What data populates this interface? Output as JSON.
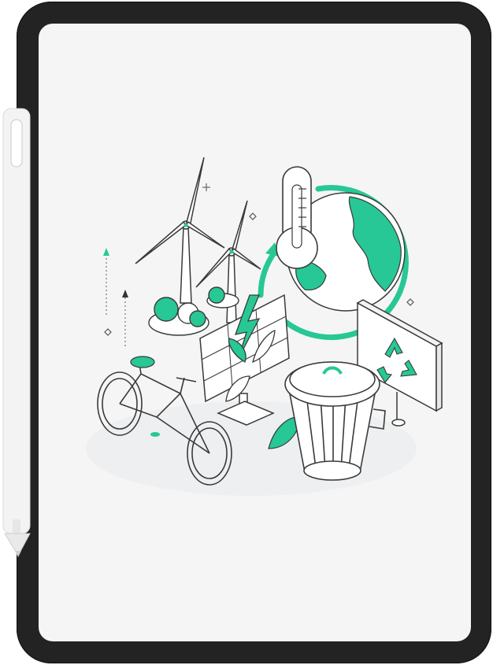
{
  "colors": {
    "bezel": "#232323",
    "screen": "#f5f5f5",
    "accent": "#27c895",
    "line": "#3a3a3a",
    "pencil": "#f3f3f3"
  },
  "icons": [
    "wind-turbine-icon",
    "thermometer-icon",
    "earth-globe-icon",
    "recycling-arrow-icon",
    "recycle-sign-icon",
    "solar-panel-icon",
    "lightning-bolt-icon",
    "plant-sprout-icon",
    "bicycle-icon",
    "trash-bin-icon",
    "leaf-icon",
    "bush-icon",
    "sparkle-icon",
    "diamond-icon",
    "arrow-up-icon"
  ]
}
